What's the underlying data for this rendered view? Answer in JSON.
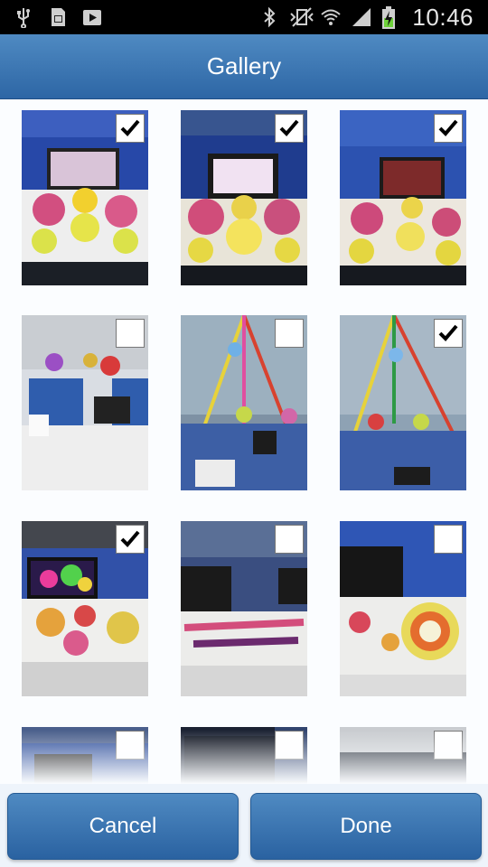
{
  "status_bar": {
    "time": "10:46",
    "icons": [
      "usb-icon",
      "sd-card-icon",
      "play-store-icon",
      "bluetooth-icon",
      "vibrate-icon",
      "wifi-icon",
      "signal-icon",
      "battery-charging-icon"
    ]
  },
  "header": {
    "title": "Gallery"
  },
  "gallery": {
    "photos": [
      {
        "scene": "diwali-desk-flowers-monitor",
        "checked": true
      },
      {
        "scene": "diwali-desk-flowers-monitor",
        "checked": true
      },
      {
        "scene": "diwali-desk-flowers-monitor",
        "checked": true
      },
      {
        "scene": "office-cubicle-balloons",
        "checked": false
      },
      {
        "scene": "office-cubicle-streamers",
        "checked": false
      },
      {
        "scene": "office-cubicle-streamers",
        "checked": true
      },
      {
        "scene": "desk-rangoli-monitor",
        "checked": true
      },
      {
        "scene": "desk-rangoli-text",
        "checked": false
      },
      {
        "scene": "desk-rangoli-diya",
        "checked": false
      },
      {
        "scene": "partial-cubicle",
        "checked": false
      },
      {
        "scene": "partial-screen-happy-diwali",
        "checked": false
      },
      {
        "scene": "partial-ceiling",
        "checked": false
      }
    ]
  },
  "buttons": {
    "cancel": "Cancel",
    "done": "Done"
  },
  "colors": {
    "accent": "#3a74b3",
    "status_bar": "#000000",
    "check": "#000000"
  }
}
